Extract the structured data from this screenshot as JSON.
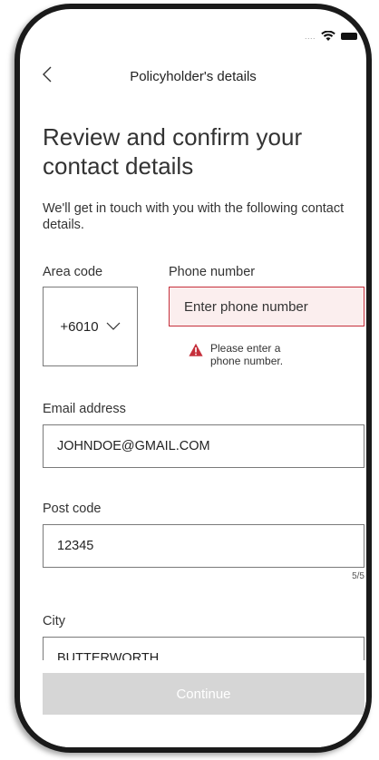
{
  "status_bar": {
    "signal_dots": "....",
    "icons": [
      "wifi-icon",
      "battery-icon"
    ]
  },
  "header": {
    "back_icon": "chevron-left-icon",
    "title": "Policyholder's details"
  },
  "main": {
    "heading": "Review and confirm your contact details",
    "intro": "We'll get in touch with you with the following contact details."
  },
  "form": {
    "area_code": {
      "label": "Area code",
      "value": "+6010"
    },
    "phone": {
      "label": "Phone number",
      "placeholder": "Enter phone number",
      "value": "",
      "error": "Please enter a phone number."
    },
    "email": {
      "label": "Email address",
      "value": "JOHNDOE@GMAIL.COM"
    },
    "post_code": {
      "label": "Post code",
      "value": "12345",
      "counter": "5/5"
    },
    "city": {
      "label": "City",
      "value": "BUTTERWORTH"
    }
  },
  "footer": {
    "continue_label": "Continue"
  },
  "colors": {
    "error": "#c52f3b",
    "error_bg": "#fbeeee",
    "button_disabled": "#d6d6d6"
  }
}
